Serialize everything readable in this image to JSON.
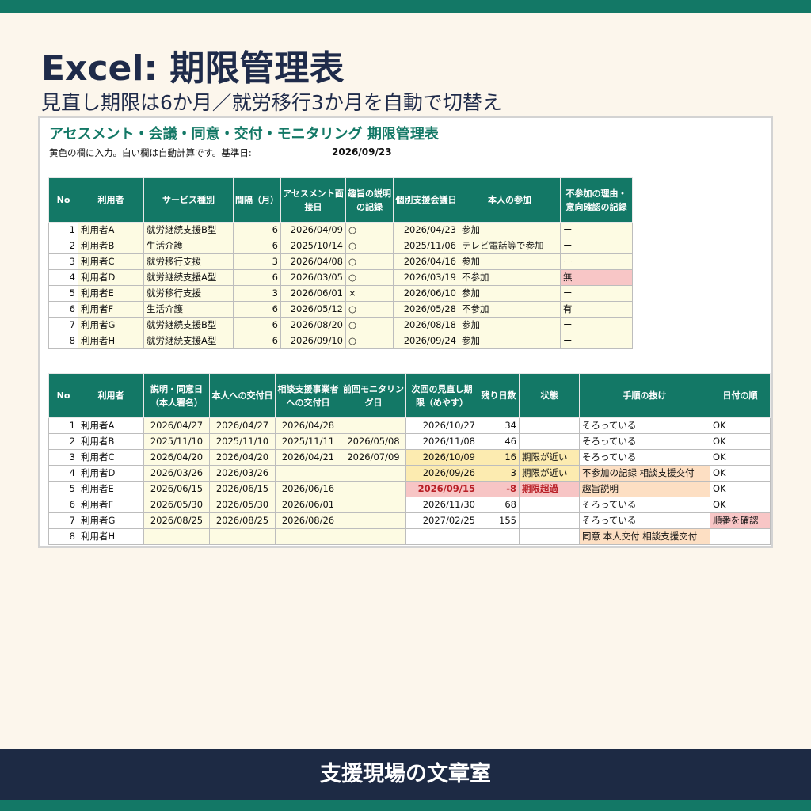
{
  "colors": {
    "accent": "#137866",
    "navy": "#1d2a44",
    "input_yellow": "#fdfbe3",
    "warning": "#fcebb0",
    "overdue": "#f7c5c5",
    "missing": "#fddfc3"
  },
  "header": {
    "title": "Excel: 期限管理表",
    "subtitle": "見直し期限は6か月／就労移行3か月を自動で切替え"
  },
  "sheet": {
    "title": "アセスメント・会議・同意・交付・モニタリング 期限管理表",
    "note": "黄色の欄に入力。白い欄は自動計算です。基準日:",
    "base_date": "2026/09/23"
  },
  "table1": {
    "headers": [
      "No",
      "利用者",
      "サービス種別",
      "間隔（月）",
      "アセスメント面接日",
      "趣旨の説明の記録",
      "個別支援会議日",
      "本人の参加",
      "不参加の理由・意向確認の記録"
    ],
    "rows": [
      [
        "1",
        "利用者A",
        "就労継続支援B型",
        "6",
        "2026/04/09",
        "○",
        "2026/04/23",
        "参加",
        "ー"
      ],
      [
        "2",
        "利用者B",
        "生活介護",
        "6",
        "2025/10/14",
        "○",
        "2025/11/06",
        "テレビ電話等で参加",
        "ー"
      ],
      [
        "3",
        "利用者C",
        "就労移行支援",
        "3",
        "2026/04/08",
        "○",
        "2026/04/16",
        "参加",
        "ー"
      ],
      [
        "4",
        "利用者D",
        "就労継続支援A型",
        "6",
        "2026/03/05",
        "○",
        "2026/03/19",
        "不参加",
        "無"
      ],
      [
        "5",
        "利用者E",
        "就労移行支援",
        "3",
        "2026/06/01",
        "×",
        "2026/06/10",
        "参加",
        "ー"
      ],
      [
        "6",
        "利用者F",
        "生活介護",
        "6",
        "2026/05/12",
        "○",
        "2026/05/28",
        "不参加",
        "有"
      ],
      [
        "7",
        "利用者G",
        "就労継続支援B型",
        "6",
        "2026/08/20",
        "○",
        "2026/08/18",
        "参加",
        "ー"
      ],
      [
        "8",
        "利用者H",
        "就労継続支援A型",
        "6",
        "2026/09/10",
        "○",
        "2026/09/24",
        "参加",
        "ー"
      ]
    ]
  },
  "table2": {
    "headers": [
      "No",
      "利用者",
      "説明・同意日（本人署名）",
      "本人への交付日",
      "相談支援事業者への交付日",
      "前回モニタリング日",
      "次回の見直し期限（めやす）",
      "残り日数",
      "状態",
      "手順の抜け",
      "日付の順"
    ],
    "rows": [
      [
        "1",
        "利用者A",
        "2026/04/27",
        "2026/04/27",
        "2026/04/28",
        "",
        "2026/10/27",
        "34",
        "",
        "そろっている",
        "OK"
      ],
      [
        "2",
        "利用者B",
        "2025/11/10",
        "2025/11/10",
        "2025/11/11",
        "2026/05/08",
        "2026/11/08",
        "46",
        "",
        "そろっている",
        "OK"
      ],
      [
        "3",
        "利用者C",
        "2026/04/20",
        "2026/04/20",
        "2026/04/21",
        "2026/07/09",
        "2026/10/09",
        "16",
        "期限が近い",
        "そろっている",
        "OK"
      ],
      [
        "4",
        "利用者D",
        "2026/03/26",
        "2026/03/26",
        "",
        "",
        "2026/09/26",
        "3",
        "期限が近い",
        "不参加の記録 相談支援交付",
        "OK"
      ],
      [
        "5",
        "利用者E",
        "2026/06/15",
        "2026/06/15",
        "2026/06/16",
        "",
        "2026/09/15",
        "-8",
        "期限超過",
        "趣旨説明",
        "OK"
      ],
      [
        "6",
        "利用者F",
        "2026/05/30",
        "2026/05/30",
        "2026/06/01",
        "",
        "2026/11/30",
        "68",
        "",
        "そろっている",
        "OK"
      ],
      [
        "7",
        "利用者G",
        "2026/08/25",
        "2026/08/25",
        "2026/08/26",
        "",
        "2027/02/25",
        "155",
        "",
        "そろっている",
        "順番を確認"
      ],
      [
        "8",
        "利用者H",
        "",
        "",
        "",
        "",
        "",
        "",
        "",
        "同意 本人交付 相談支援交付",
        ""
      ]
    ]
  },
  "footer": {
    "label": "支援現場の文章室"
  }
}
